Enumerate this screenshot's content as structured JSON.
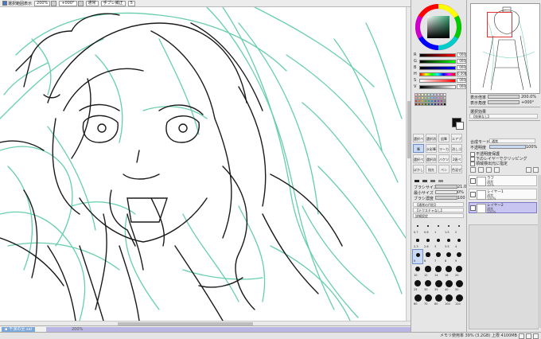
{
  "toolbar": {
    "items": [
      {
        "label": "選択範囲表示",
        "checked": true
      },
      {
        "label": "200%"
      },
      {
        "label": "+000°"
      },
      {
        "label": "通常"
      },
      {
        "label": "手ブレ補正"
      },
      {
        "label": "5"
      }
    ]
  },
  "file": {
    "tab_label": "千涙の至.sai",
    "zoom": "200%"
  },
  "status": {
    "text": "メモリ使用率 39% (3.2GB) 上限 4100MB"
  },
  "color_panel": {
    "sliders": [
      {
        "label": "R",
        "value": "000",
        "colors": [
          "#000000",
          "#ff0000"
        ]
      },
      {
        "label": "G",
        "value": "000",
        "colors": [
          "#000000",
          "#00ff00"
        ]
      },
      {
        "label": "B",
        "value": "000",
        "colors": [
          "#000000",
          "#0000ff"
        ]
      },
      {
        "label": "H",
        "value": "0.000",
        "colors": [
          "#ff0000",
          "#ffff00",
          "#00ff00",
          "#00ffff",
          "#0000ff",
          "#ff00ff",
          "#ff0000"
        ]
      },
      {
        "label": "S",
        "value": "000",
        "colors": [
          "#ffffff",
          "#ff0000"
        ]
      },
      {
        "label": "V",
        "value": "000",
        "colors": [
          "#000000",
          "#ffffff"
        ]
      }
    ],
    "swatches": [
      "#f4c7c7",
      "#f7d7b5",
      "#f6efb0",
      "#d6f0b8",
      "#b8eed8",
      "#b8dff6",
      "#c8c8f6",
      "#e6c4f0",
      "#f0c0d8",
      "#ffffff",
      "#e89090",
      "#ecb07a",
      "#e8dc6a",
      "#a6da78",
      "#78d8b8",
      "#78bce8",
      "#9898e8",
      "#c890e0",
      "#e088b8",
      "#cccccc",
      "#c44848",
      "#d07a30",
      "#c8b420",
      "#5aa838",
      "#28a888",
      "#2e82c8",
      "#5050c0",
      "#8e48b8",
      "#c04888",
      "#888888",
      "#7a2020",
      "#884010",
      "#7a6a08",
      "#2e6a1a",
      "#106a58",
      "#14508a",
      "#2a2a80",
      "#5a2478",
      "#7a1e50",
      "#000000"
    ]
  },
  "tools": {
    "buttons": [
      "選択ペン",
      "選択消し",
      "鉛筆",
      "エアブラシ",
      "筆",
      "水彩筆",
      "マーカー",
      "消しゴム",
      "選択ペン",
      "選択消し",
      "バケツ",
      "2値ペン",
      "ぼかし",
      "指先",
      "ペン",
      "色混ぜ"
    ],
    "brush_size_label": "ブラシサイズ",
    "brush_size_value": "21.0",
    "min_size_label": "最小サイズ",
    "min_size_value": "0%",
    "density_label": "ブラシ濃度",
    "density_value": "100",
    "option1": "【通常の円形】",
    "option2": "【テクスチャなし】",
    "option3": "詳細設定",
    "dot_sizes": [
      "0.7",
      "0.8",
      "1",
      "1.5",
      "2",
      "2.3",
      "2.6",
      "3",
      "3.5",
      "4",
      "5",
      "6",
      "7",
      "8",
      "9",
      "10",
      "12",
      "14",
      "16",
      "20",
      "25",
      "30",
      "35",
      "40",
      "50",
      "60",
      "70",
      "80",
      "100",
      "120"
    ]
  },
  "navigator": {
    "zoom_label": "表示倍率",
    "zoom_value": "200.0%",
    "angle_label": "表示角度",
    "angle_value": "+000°"
  },
  "layer_panel": {
    "effect_label": "選択効果",
    "effect_value": "【効果なし】",
    "mode_label": "合成モード",
    "mode_value": "通常",
    "opacity_label": "不透明度",
    "opacity_value": "100%",
    "check1": "不透明度保護",
    "check2": "下のレイヤーでクリッピング",
    "check3": "領域検出元に指定",
    "layers": [
      {
        "name": "ラフ",
        "mode": "通常",
        "opacity": "10%",
        "selected": false
      },
      {
        "name": "レイヤー1",
        "mode": "通常",
        "opacity": "100%",
        "selected": false
      },
      {
        "name": "レイヤー2",
        "mode": "通常",
        "opacity": "100%",
        "selected": true
      }
    ]
  }
}
